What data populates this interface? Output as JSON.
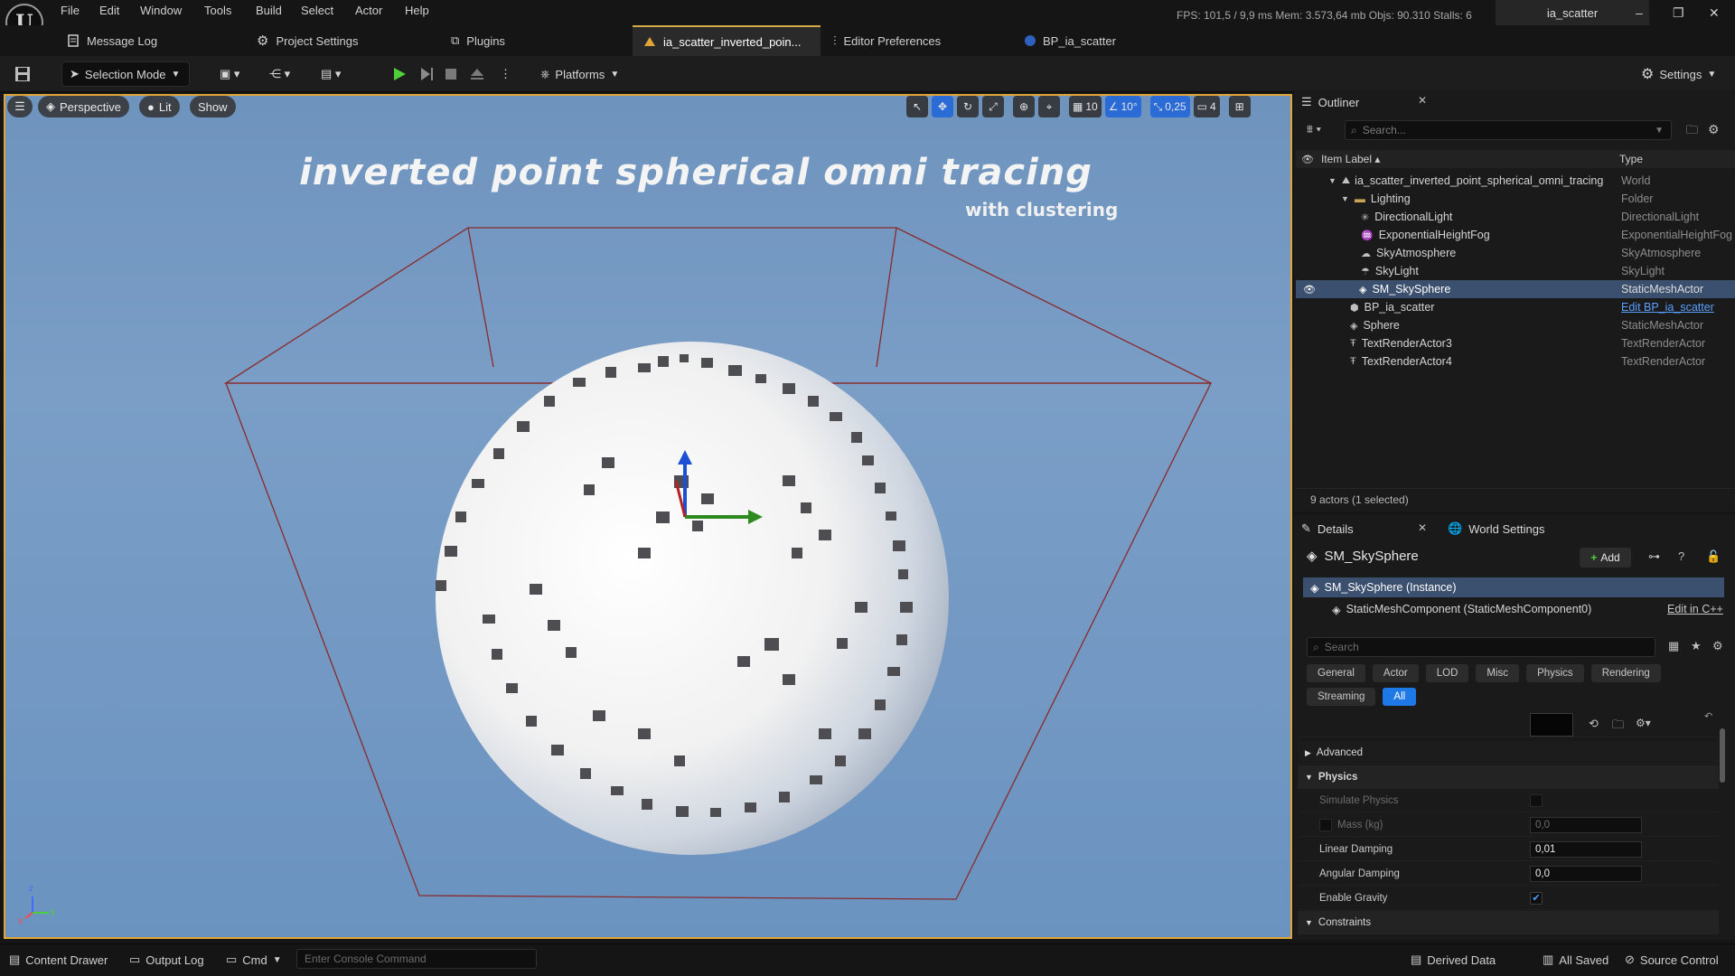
{
  "app": {
    "logo_glyph": "U",
    "project_tab": "ia_scatter"
  },
  "menu": [
    "File",
    "Edit",
    "Window",
    "Tools",
    "Build",
    "Select",
    "Actor",
    "Help"
  ],
  "stats": {
    "text": "FPS: 101,5  /  9,9 ms   Mem: 3.573,64 mb   Objs: 90.310   Stalls: 6"
  },
  "window_controls": {
    "minimize": "–",
    "restore": "❐",
    "close": "✕"
  },
  "tabs": [
    {
      "label": "Message Log",
      "icon": "message-log-icon"
    },
    {
      "label": "Project Settings",
      "icon": "gear-icon"
    },
    {
      "label": "Plugins",
      "icon": "plugin-icon"
    },
    {
      "label": "ia_scatter_inverted_poin...",
      "icon": "level-icon",
      "active": true
    },
    {
      "label": "Editor Preferences",
      "icon": "sliders-icon"
    },
    {
      "label": "BP_ia_scatter",
      "icon": "blueprint-icon"
    }
  ],
  "toolbar": {
    "selection_mode": "Selection Mode",
    "platforms": "Platforms",
    "settings": "Settings"
  },
  "viewport": {
    "perspective": "Perspective",
    "lit": "Lit",
    "show": "Show",
    "grid_size": "10",
    "rotation_snap": "10°",
    "scale_snap": "0,25",
    "camera_speed": "4",
    "title_text": "inverted point spherical omni tracing",
    "subtitle_text": "with clustering",
    "axis_x": "x",
    "axis_y": "y",
    "axis_z": "z"
  },
  "outliner": {
    "tab": "Outliner",
    "search_placeholder": "Search...",
    "col_label": "Item Label ▴",
    "col_type": "Type",
    "items": [
      {
        "label": "ia_scatter_inverted_point_spherical_omni_tracing",
        "type": "World",
        "indent": 0,
        "expanded": true
      },
      {
        "label": "Lighting",
        "type": "Folder",
        "indent": 1,
        "expanded": true
      },
      {
        "label": "DirectionalLight",
        "type": "DirectionalLight",
        "indent": 2
      },
      {
        "label": "ExponentialHeightFog",
        "type": "ExponentialHeightFog",
        "indent": 2
      },
      {
        "label": "SkyAtmosphere",
        "type": "SkyAtmosphere",
        "indent": 2
      },
      {
        "label": "SkyLight",
        "type": "SkyLight",
        "indent": 2
      },
      {
        "label": "SM_SkySphere",
        "type": "StaticMeshActor",
        "indent": 2,
        "selected": true
      },
      {
        "label": "BP_ia_scatter",
        "type": "Edit BP_ia_scatter",
        "indent": 1,
        "link": true
      },
      {
        "label": "Sphere",
        "type": "StaticMeshActor",
        "indent": 1
      },
      {
        "label": "TextRenderActor3",
        "type": "TextRenderActor",
        "indent": 1
      },
      {
        "label": "TextRenderActor4",
        "type": "TextRenderActor",
        "indent": 1
      }
    ],
    "footer": "9 actors (1 selected)"
  },
  "details": {
    "tab": "Details",
    "world_settings_tab": "World Settings",
    "actor_name": "SM_SkySphere",
    "add_label": "Add",
    "instance_row": "SM_SkySphere (Instance)",
    "component_row": "StaticMeshComponent (StaticMeshComponent0)",
    "edit_cpp": "Edit in C++",
    "search_placeholder": "Search",
    "filters": [
      "General",
      "Actor",
      "LOD",
      "Misc",
      "Physics",
      "Rendering",
      "Streaming",
      "All"
    ],
    "active_filter": "All",
    "sections": {
      "advanced": "Advanced",
      "physics": "Physics",
      "constraints": "Constraints"
    },
    "props": {
      "simulate_physics": "Simulate Physics",
      "mass": "Mass (kg)",
      "mass_value": "0,0",
      "linear_damping": "Linear Damping",
      "linear_damping_value": "0,01",
      "angular_damping": "Angular Damping",
      "angular_damping_value": "0,0",
      "enable_gravity": "Enable Gravity"
    }
  },
  "statusbar": {
    "content_drawer": "Content Drawer",
    "output_log": "Output Log",
    "cmd": "Cmd",
    "console_placeholder": "Enter Console Command",
    "derived_data": "Derived Data",
    "all_saved": "All Saved",
    "source_control": "Source Control"
  },
  "colors": {
    "viewport_border": "#e0a536",
    "selection": "#3b4f6e",
    "accent_blue": "#1e78e6",
    "sky": "#7399c2"
  }
}
